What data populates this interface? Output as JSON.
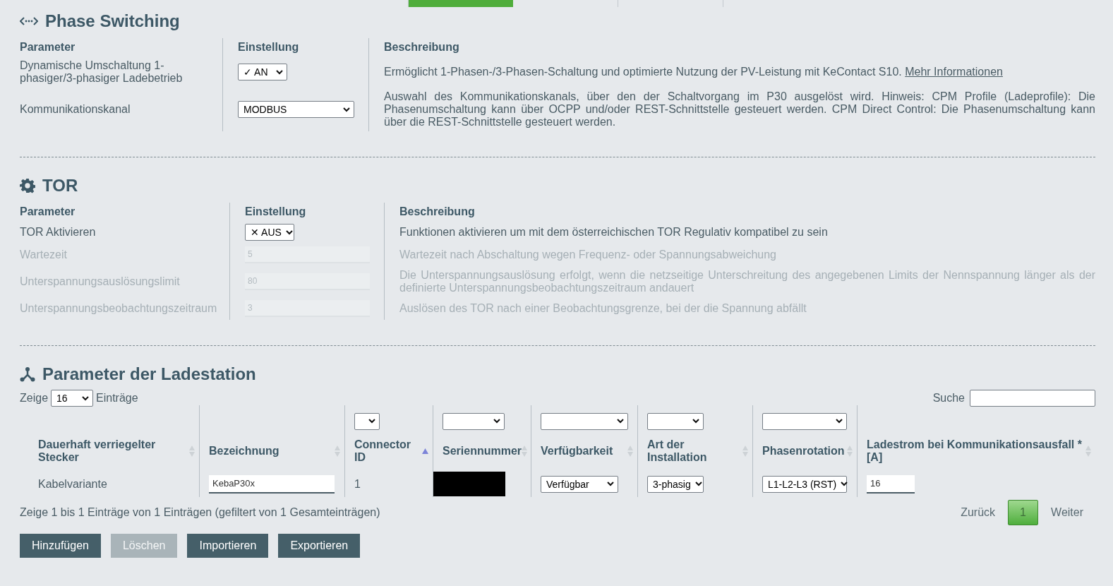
{
  "tabs": [
    {
      "selected": false
    },
    {
      "selected": true
    },
    {
      "selected": false
    },
    {
      "selected": false
    }
  ],
  "phase_switching": {
    "title": "Phase Switching",
    "columns": [
      "Parameter",
      "Einstellung",
      "Beschreibung"
    ],
    "rows": [
      {
        "label": "Dynamische Umschaltung 1-phasiger/3-phasiger Ladebetrieb",
        "kind": "select",
        "value": "✓ AN",
        "disabled": false,
        "description": "Ermöglicht 1-Phasen-/3-Phasen-Schaltung und optimierte Nutzung der PV-Leistung mit KeContact S10.",
        "link": "Mehr Informationen"
      },
      {
        "label": "Kommunikationskanal",
        "kind": "select",
        "value": "MODBUS",
        "disabled": false,
        "description": "Auswahl des Kommunikationskanals, über den der Schaltvorgang im P30 ausgelöst wird. Hinweis: CPM Profile (Ladeprofile): Die Phasenumschaltung kann über OCPP und/oder REST-Schnittstelle gesteuert werden. CPM Direct Control: Die Phasenumschaltung kann über die REST-Schnittstelle gesteuert werden."
      }
    ]
  },
  "tor": {
    "title": "TOR",
    "columns": [
      "Parameter",
      "Einstellung",
      "Beschreibung"
    ],
    "rows": [
      {
        "label": "TOR Aktivieren",
        "kind": "select",
        "value": "✕ AUS",
        "disabled": false,
        "description": "Funktionen aktivieren um mit dem österreichischen TOR Regulativ kompatibel zu sein"
      },
      {
        "label": "Wartezeit",
        "kind": "input",
        "value": "5",
        "disabled": true,
        "description": "Wartezeit nach Abschaltung wegen Frequenz- oder Spannungsabweichung"
      },
      {
        "label": "Unterspannungsauslösungslimit",
        "kind": "input",
        "value": "80",
        "disabled": true,
        "description": "Die Unterspannungsauslösung erfolgt, wenn die netzseitige Unterschreitung des angegebenen Limits der Nennspannung länger als der definierte Unterspannungsbeobachtungszeitraum andauert"
      },
      {
        "label": "Unterspannungsbeobachtungszeitraum",
        "kind": "input",
        "value": "3",
        "disabled": true,
        "description": "Auslösen des TOR nach einer Beobachtungsgrenze, bei der die Spannung abfällt"
      }
    ]
  },
  "ladestation": {
    "title": "Parameter der Ladestation",
    "show_label": "Zeige",
    "page_length": "16",
    "entries_label": "Einträge",
    "search_label": "Suche",
    "columns": [
      {
        "label": "Dauerhaft verriegelter Stecker",
        "filter": false,
        "sorted": false
      },
      {
        "label": "Bezeichnung",
        "filter": false,
        "sorted": false
      },
      {
        "label": "Connector ID",
        "filter": true,
        "sorted": true
      },
      {
        "label": "Seriennummer",
        "filter": true,
        "sorted": false
      },
      {
        "label": "Verfügbarkeit",
        "filter": true,
        "sorted": false
      },
      {
        "label": "Art der Installation",
        "filter": true,
        "sorted": false
      },
      {
        "label": "Phasenrotation",
        "filter": true,
        "sorted": false
      },
      {
        "label": "Ladestrom bei Kommunikationsausfall * [A]",
        "filter": false,
        "sorted": false
      }
    ],
    "rows": [
      [
        {
          "kind": "text",
          "value": "Kabelvariante"
        },
        {
          "kind": "input",
          "value": "KebaP30x"
        },
        {
          "kind": "text",
          "value": "1"
        },
        {
          "kind": "redacted"
        },
        {
          "kind": "select",
          "value": "Verfügbar"
        },
        {
          "kind": "select",
          "value": "3-phasig"
        },
        {
          "kind": "select",
          "value": "L1-L2-L3 (RST)"
        },
        {
          "kind": "input",
          "value": "16"
        }
      ]
    ],
    "info": "Zeige 1 bis 1 Einträge von 1 Einträgen (gefiltert von 1 Gesamteinträgen)",
    "pagination": [
      {
        "label": "Zurück",
        "kind": "link",
        "selected": false
      },
      {
        "label": "1",
        "kind": "page",
        "selected": true
      },
      {
        "label": "Weiter",
        "kind": "link",
        "selected": false
      }
    ],
    "buttons": [
      {
        "label": "Hinzufügen",
        "disabled": false
      },
      {
        "label": "Löschen",
        "disabled": true
      },
      {
        "label": "Importieren",
        "disabled": false
      },
      {
        "label": "Exportieren",
        "disabled": false
      }
    ]
  }
}
